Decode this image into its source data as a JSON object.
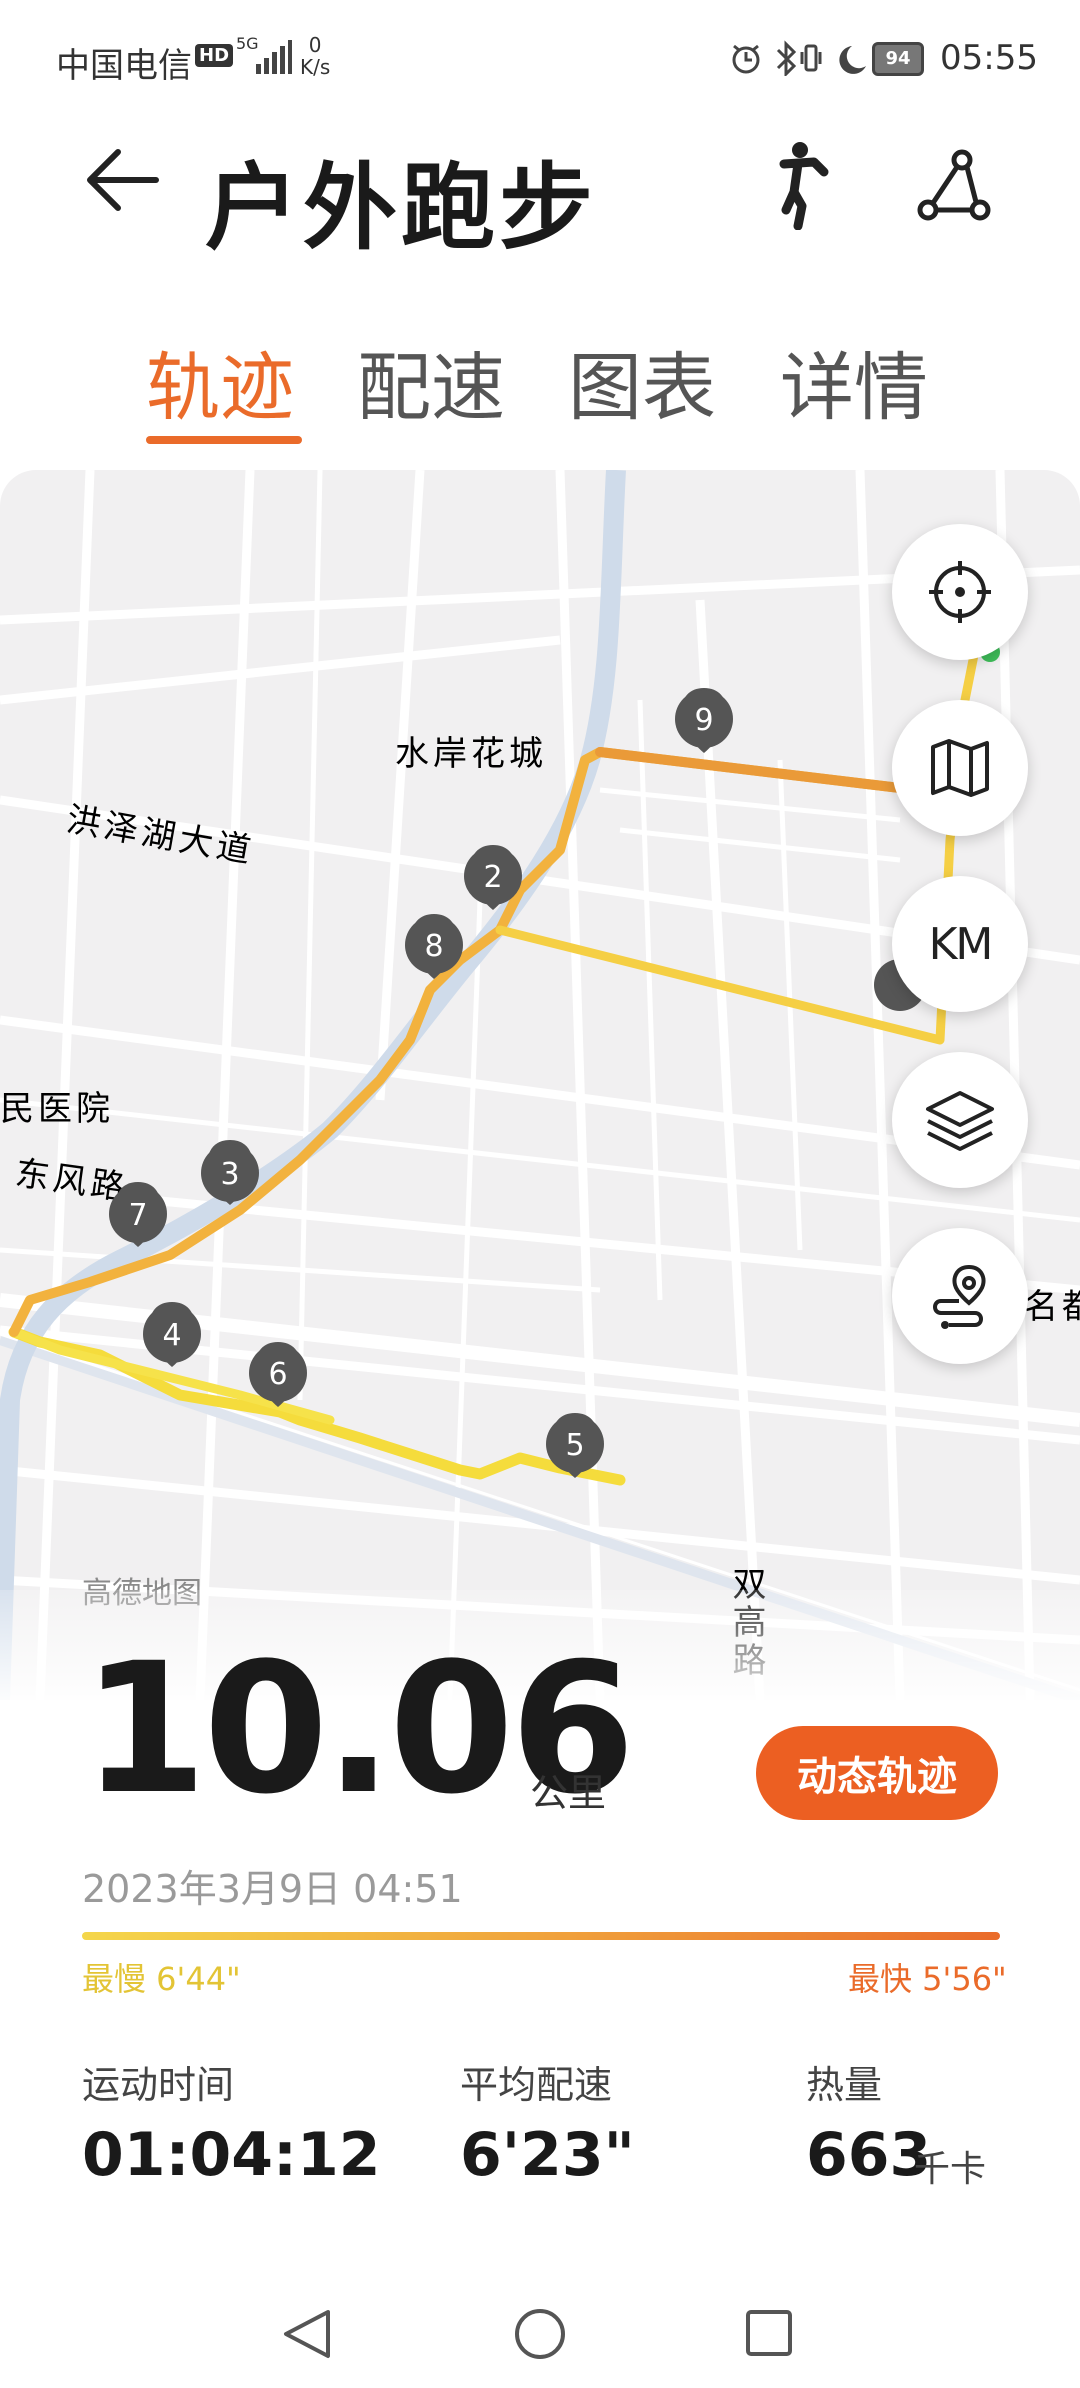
{
  "status_bar": {
    "carrier": "中国电信",
    "hd": "HD",
    "network": "5G",
    "speed_value": "0",
    "speed_unit": "K/s",
    "battery": "94",
    "time": "05:55"
  },
  "header": {
    "title": "户外跑步",
    "back_icon": "arrow-left-icon",
    "activity_icon": "runner-icon",
    "share_icon": "share-icon"
  },
  "tabs": [
    {
      "label": "轨迹",
      "active": true
    },
    {
      "label": "配速",
      "active": false
    },
    {
      "label": "图表",
      "active": false
    },
    {
      "label": "详情",
      "active": false
    }
  ],
  "map": {
    "place_labels": {
      "shuian": "水岸花城",
      "hongze": "洪泽湖大道",
      "hospital": "民医院",
      "dongfeng": "东风路",
      "shuanggao_road": "双高路",
      "mingdu": "名都"
    },
    "km_markers": [
      "2",
      "3",
      "4",
      "5",
      "6",
      "7",
      "8",
      "9"
    ],
    "provider": "高德地图",
    "controls": [
      {
        "icon": "locate-icon"
      },
      {
        "icon": "map-icon"
      },
      {
        "label": "KM"
      },
      {
        "icon": "layers-icon"
      },
      {
        "icon": "route-pin-icon"
      }
    ],
    "track_colors": {
      "slow": "#f4d64a",
      "mid": "#f2b23e",
      "fast": "#ea8a34"
    }
  },
  "summary": {
    "distance": "10.06",
    "distance_unit": "公里",
    "dynamic_track_button": "动态轨迹",
    "datetime": "2023年3月9日 04:51",
    "slowest_label": "最慢 6'44\"",
    "fastest_label": "最快 5'56\"",
    "stats": [
      {
        "label": "运动时间",
        "value": "01:04:12",
        "unit": ""
      },
      {
        "label": "平均配速",
        "value": "6'23\"",
        "unit": ""
      },
      {
        "label": "热量",
        "value": "663",
        "unit": "千卡"
      }
    ]
  },
  "accent_color": "#ea6b2a"
}
